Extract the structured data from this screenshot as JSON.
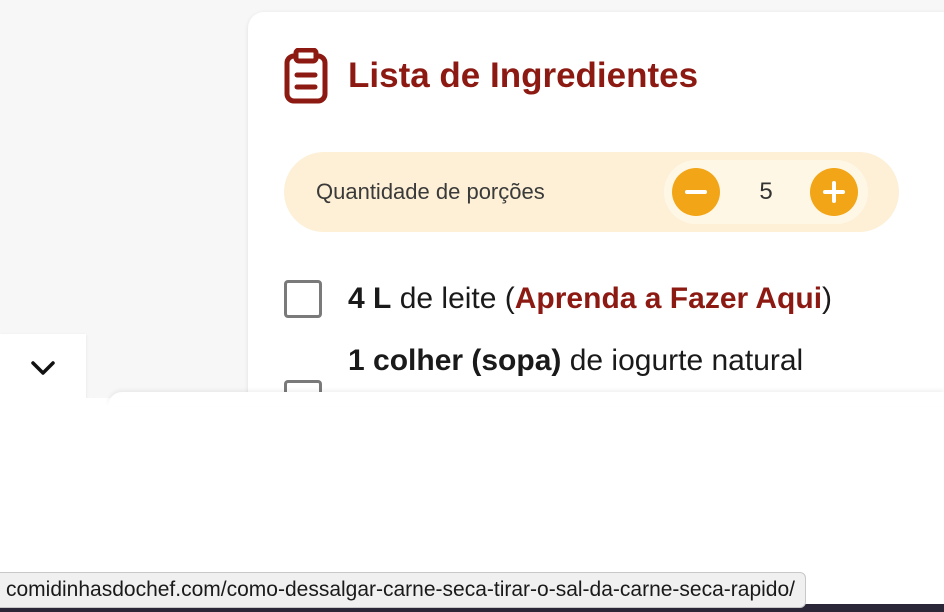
{
  "card": {
    "title": "Lista de Ingredientes",
    "icon": "clipboard-icon",
    "title_color": "#8c1a12"
  },
  "portions": {
    "label": "Quantidade de porções",
    "value": "5",
    "minus_icon": "minus-icon",
    "plus_icon": "plus-icon",
    "button_color": "#f2a516",
    "background_color": "#fdf0d6"
  },
  "ingredients": [
    {
      "quantity": "4 L",
      "text": " de leite (",
      "link_text": "Aprenda a Fazer Aqui",
      "after_link": ")"
    },
    {
      "quantity": "1 colher (sopa)",
      "text": " de iogurte natural"
    }
  ],
  "collapse_tab": {
    "icon": "chevron-down-icon"
  },
  "status_bar": {
    "url": "comidinhasdochef.com/como-dessalgar-carne-seca-tirar-o-sal-da-carne-seca-rapido/"
  }
}
